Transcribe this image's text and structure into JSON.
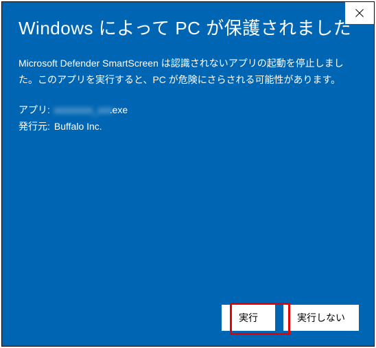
{
  "dialog": {
    "title": "Windows によって PC が保護されました",
    "message": "Microsoft Defender SmartScreen は認識されないアプリの起動を停止しました。このアプリを実行すると、PC が危険にさらされる可能性があります。",
    "app_label": "アプリ:",
    "app_value_blurred": "xxxxxxxx_xxx",
    "app_value_suffix": ".exe",
    "publisher_label": "発行元:",
    "publisher_value": "Buffalo Inc."
  },
  "buttons": {
    "run": "実行",
    "dont_run": "実行しない"
  },
  "icons": {
    "close": "close-icon"
  },
  "highlight": {
    "target": "run-button"
  }
}
